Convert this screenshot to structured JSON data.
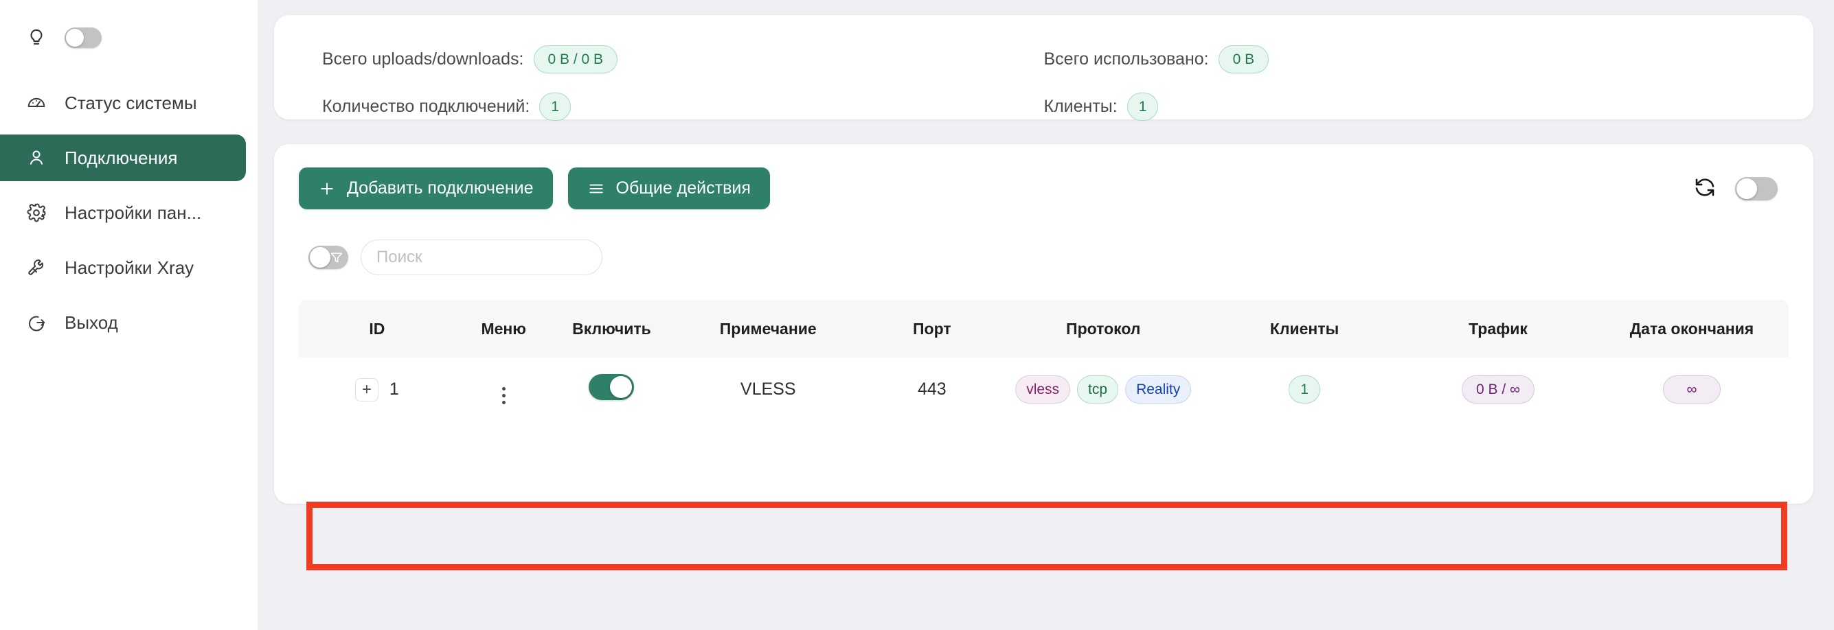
{
  "sidebar": {
    "theme_toggle": {
      "name": "theme-toggle",
      "state": "off"
    },
    "bulb_icon": "lightbulb-icon",
    "items": [
      {
        "label": "Статус системы",
        "icon": "dashboard-icon",
        "active": false
      },
      {
        "label": "Подключения",
        "icon": "user-icon",
        "active": true
      },
      {
        "label": "Настройки пан...",
        "icon": "gear-icon",
        "active": false
      },
      {
        "label": "Настройки Xray",
        "icon": "wrench-icon",
        "active": false
      },
      {
        "label": "Выход",
        "icon": "logout-icon",
        "active": false
      }
    ]
  },
  "stats": {
    "uploads_label": "Всего uploads/downloads:",
    "uploads_value": "0 B / 0 B",
    "connections_label": "Количество подключений:",
    "connections_value": "1",
    "used_label": "Всего использовано:",
    "used_value": "0 B",
    "clients_label": "Клиенты:",
    "clients_value": "1"
  },
  "toolbar": {
    "add_label": "Добавить подключение",
    "add_icon": "plus-icon",
    "bulk_label": "Общие действия",
    "bulk_icon": "hamburger-icon",
    "refresh_icon": "refresh-icon",
    "auto_refresh_toggle": "off"
  },
  "search": {
    "placeholder": "Поиск",
    "value": "",
    "filter_icon": "funnel-icon",
    "filter_toggle": "off"
  },
  "table": {
    "columns": [
      "ID",
      "Меню",
      "Включить",
      "Примечание",
      "Порт",
      "Протокол",
      "Клиенты",
      "Трафик",
      "Дата окончания"
    ],
    "rows": [
      {
        "id": "1",
        "expand_icon": "plus-icon",
        "menu_icon": "vertical-dots-icon",
        "enabled": "on",
        "remark": "VLESS",
        "port": "443",
        "protocol_tags": [
          "vless",
          "tcp",
          "Reality"
        ],
        "clients": "1",
        "traffic": "0 B / ∞",
        "expiry": "∞",
        "highlighted": true
      }
    ]
  },
  "colors": {
    "accent_green": "#2f8068",
    "sidebar_active": "#2b6b57",
    "highlight_red": "#ee3d23",
    "page_bg": "#f0f0f4",
    "tag_vless": "#8a1f6d",
    "tag_tcp": "#18694a",
    "tag_reality": "#1342b4"
  }
}
